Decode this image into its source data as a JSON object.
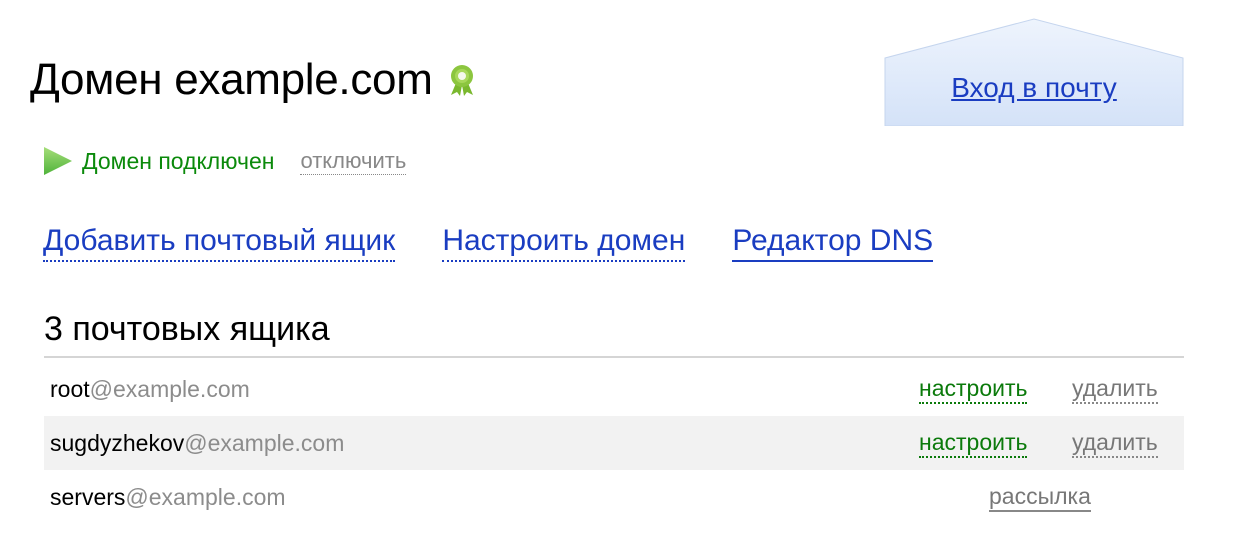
{
  "header": {
    "title": "Домен example.com",
    "verified_icon": "verified-badge-icon",
    "mail_button_label": "Вход в почту"
  },
  "status": {
    "icon": "play-icon",
    "text": "Домен подключен",
    "disconnect_label": "отключить"
  },
  "actions": {
    "add_mailbox": "Добавить почтовый ящик",
    "configure_domain": "Настроить домен",
    "dns_editor": "Редактор DNS"
  },
  "mailboxes": {
    "heading": "3 почтовых ящика",
    "rows": [
      {
        "user": "root",
        "domain": "@example.com",
        "configure_label": "настроить",
        "delete_label": "удалить"
      },
      {
        "user": "sugdyzhekov",
        "domain": "@example.com",
        "configure_label": "настроить",
        "delete_label": "удалить"
      },
      {
        "user": "servers",
        "domain": "@example.com",
        "list_label": "рассылка"
      }
    ]
  },
  "colors": {
    "link_blue": "#1a3dc1",
    "status_green": "#0b8a0b",
    "muted_gray": "#8c8c8c",
    "mail_box_fill": "#dce8fb"
  }
}
